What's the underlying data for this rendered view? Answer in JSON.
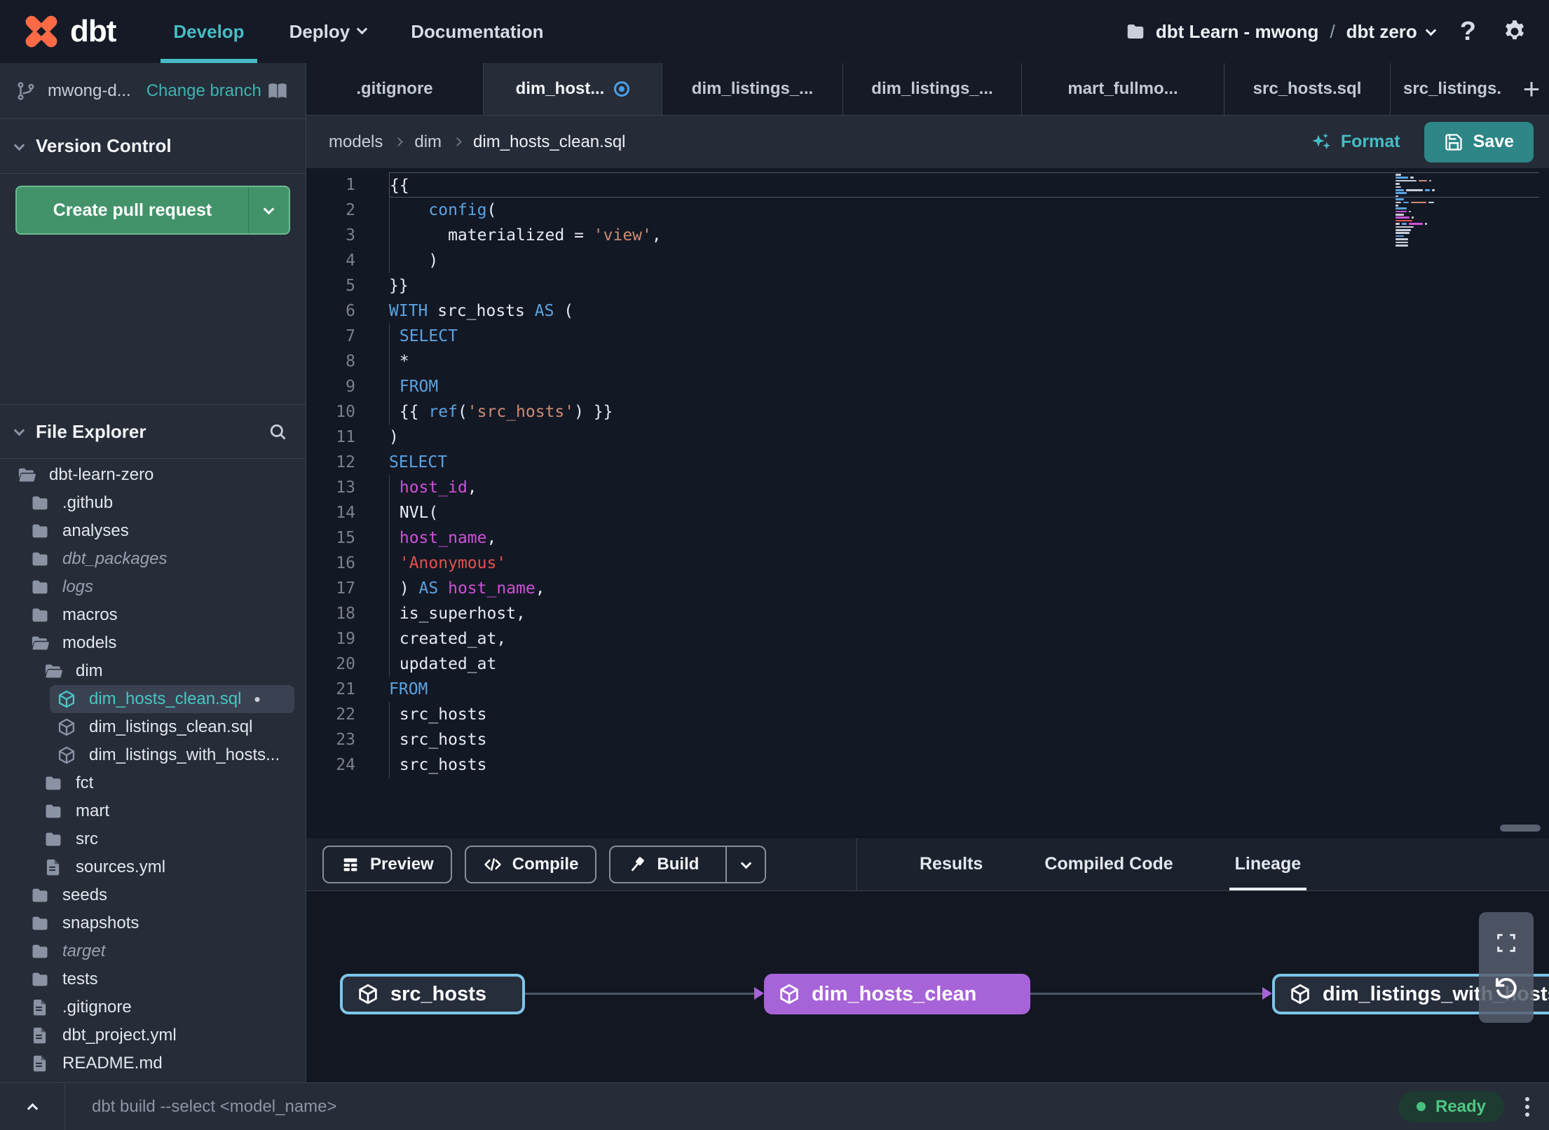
{
  "colors": {
    "accent_teal": "#45BCC5",
    "link_teal": "#3FB3B0",
    "pr_button_green": "#43936A",
    "save_button_teal": "#2E8686",
    "ready_green": "#4FC684",
    "lineage_node_cyan": "#7CC5E8",
    "lineage_node_purple": "#A763D8",
    "syntax_keyword_blue": "#5BA3E0",
    "syntax_string_salmon": "#CE8C75",
    "syntax_string_red": "#E0524C",
    "syntax_column_magenta": "#CE51D6",
    "modified_indicator_blue": "#4A9FE8"
  },
  "glyphs": {
    "modified_dot": "•",
    "add_tab": "+",
    "help": "?"
  },
  "navbar": {
    "logo_text": "dbt",
    "items": [
      {
        "label": "Develop",
        "active": true
      },
      {
        "label": "Deploy",
        "has_chevron": true
      },
      {
        "label": "Documentation"
      }
    ],
    "project": {
      "account": "dbt Learn - mwong",
      "separator": "/",
      "name": "dbt zero"
    }
  },
  "sidebar": {
    "branch": {
      "name": "mwong-d...",
      "change_label": "Change branch"
    },
    "version_control_title": "Version Control",
    "create_pr_label": "Create pull request",
    "file_explorer_title": "File Explorer",
    "tree": [
      {
        "label": "dbt-learn-zero",
        "icon": "folder-open",
        "depth": 0
      },
      {
        "label": ".github",
        "icon": "folder",
        "depth": 1
      },
      {
        "label": "analyses",
        "icon": "folder",
        "depth": 1
      },
      {
        "label": "dbt_packages",
        "icon": "folder",
        "depth": 1,
        "italic": true
      },
      {
        "label": "logs",
        "icon": "folder",
        "depth": 1,
        "italic": true
      },
      {
        "label": "macros",
        "icon": "folder",
        "depth": 1
      },
      {
        "label": "models",
        "icon": "folder-open",
        "depth": 1
      },
      {
        "label": "dim",
        "icon": "folder-open",
        "depth": 2
      },
      {
        "label": "dim_hosts_clean.sql",
        "icon": "model",
        "depth": 3,
        "selected": true,
        "modified": true
      },
      {
        "label": "dim_listings_clean.sql",
        "icon": "model",
        "depth": 3
      },
      {
        "label": "dim_listings_with_hosts...",
        "icon": "model",
        "depth": 3
      },
      {
        "label": "fct",
        "icon": "folder",
        "depth": 2
      },
      {
        "label": "mart",
        "icon": "folder",
        "depth": 2
      },
      {
        "label": "src",
        "icon": "folder",
        "depth": 2
      },
      {
        "label": "sources.yml",
        "icon": "file",
        "depth": 2
      },
      {
        "label": "seeds",
        "icon": "folder",
        "depth": 1
      },
      {
        "label": "snapshots",
        "icon": "folder",
        "depth": 1
      },
      {
        "label": "target",
        "icon": "folder",
        "depth": 1,
        "italic": true
      },
      {
        "label": "tests",
        "icon": "folder",
        "depth": 1
      },
      {
        "label": ".gitignore",
        "icon": "file",
        "depth": 1
      },
      {
        "label": "dbt_project.yml",
        "icon": "file",
        "depth": 1
      },
      {
        "label": "README.md",
        "icon": "file",
        "depth": 1
      }
    ]
  },
  "tabs": [
    {
      "label": ".gitignore"
    },
    {
      "label": "dim_host...",
      "active": true,
      "modified": true
    },
    {
      "label": "dim_listings_..."
    },
    {
      "label": "dim_listings_..."
    },
    {
      "label": "mart_fullmo..."
    },
    {
      "label": "src_hosts.sql"
    },
    {
      "label": "src_listings."
    }
  ],
  "editor_header": {
    "breadcrumb": [
      "models",
      "dim",
      "dim_hosts_clean.sql"
    ],
    "format_label": "Format",
    "save_label": "Save"
  },
  "editor": {
    "language": "sql",
    "lines": [
      {
        "n": 1,
        "cur": true,
        "t": [
          [
            "{{",
            "p"
          ]
        ]
      },
      {
        "n": 2,
        "g": true,
        "t": [
          [
            "    ",
            "p"
          ],
          [
            "config",
            "k"
          ],
          [
            "(",
            "p"
          ]
        ]
      },
      {
        "n": 3,
        "g": true,
        "t": [
          [
            "      materialized = ",
            "p"
          ],
          [
            "'view'",
            "s"
          ],
          [
            ",",
            "p"
          ]
        ]
      },
      {
        "n": 4,
        "g": true,
        "t": [
          [
            "    )",
            "p"
          ]
        ]
      },
      {
        "n": 5,
        "t": [
          [
            "}}",
            "p"
          ]
        ]
      },
      {
        "n": 6,
        "t": [
          [
            "WITH",
            "k"
          ],
          [
            " src_hosts ",
            "p"
          ],
          [
            "AS",
            "k"
          ],
          [
            " (",
            "p"
          ]
        ]
      },
      {
        "n": 7,
        "g": true,
        "t": [
          [
            " ",
            "p"
          ],
          [
            "SELECT",
            "k"
          ]
        ]
      },
      {
        "n": 8,
        "g": true,
        "t": [
          [
            " *",
            "p"
          ]
        ]
      },
      {
        "n": 9,
        "g": true,
        "t": [
          [
            " ",
            "p"
          ],
          [
            "FROM",
            "k"
          ]
        ]
      },
      {
        "n": 10,
        "g": true,
        "t": [
          [
            " {{ ",
            "p"
          ],
          [
            "ref",
            "k"
          ],
          [
            "(",
            "p"
          ],
          [
            "'src_hosts'",
            "s"
          ],
          [
            ") }}",
            "p"
          ]
        ]
      },
      {
        "n": 11,
        "t": [
          [
            ")",
            "p"
          ]
        ]
      },
      {
        "n": 12,
        "t": [
          [
            "SELECT",
            "k"
          ]
        ]
      },
      {
        "n": 13,
        "g": true,
        "t": [
          [
            " ",
            "p"
          ],
          [
            "host_id",
            "m"
          ],
          [
            ",",
            "p"
          ]
        ]
      },
      {
        "n": 14,
        "g": true,
        "t": [
          [
            " NVL(",
            "p"
          ]
        ]
      },
      {
        "n": 15,
        "g": true,
        "t": [
          [
            " ",
            "p"
          ],
          [
            "host_name",
            "m"
          ],
          [
            ",",
            "p"
          ]
        ]
      },
      {
        "n": 16,
        "g": true,
        "t": [
          [
            " ",
            "p"
          ],
          [
            "'Anonymous'",
            "r"
          ]
        ]
      },
      {
        "n": 17,
        "g": true,
        "t": [
          [
            " ) ",
            "p"
          ],
          [
            "AS",
            "k"
          ],
          [
            " ",
            "p"
          ],
          [
            "host_name",
            "m"
          ],
          [
            ",",
            "p"
          ]
        ]
      },
      {
        "n": 18,
        "g": true,
        "t": [
          [
            " is_superhost,",
            "p"
          ]
        ]
      },
      {
        "n": 19,
        "g": true,
        "t": [
          [
            " created_at,",
            "p"
          ]
        ]
      },
      {
        "n": 20,
        "g": true,
        "t": [
          [
            " updated_at",
            "p"
          ]
        ]
      },
      {
        "n": 21,
        "t": [
          [
            "FROM",
            "k"
          ]
        ]
      },
      {
        "n": 22,
        "g": true,
        "t": [
          [
            " src_hosts",
            "p"
          ]
        ]
      },
      {
        "n": 23,
        "g": true,
        "t": [
          [
            " src_hosts",
            "p"
          ]
        ]
      },
      {
        "n": 24,
        "g": true,
        "t": [
          [
            " src_hosts",
            "p"
          ]
        ]
      }
    ]
  },
  "bottom_toolbar": {
    "buttons": [
      {
        "label": "Preview"
      },
      {
        "label": "Compile"
      },
      {
        "label": "Build",
        "has_dropdown": true
      }
    ],
    "tabs": [
      {
        "label": "Results"
      },
      {
        "label": "Compiled Code"
      },
      {
        "label": "Lineage",
        "active": true
      }
    ]
  },
  "lineage": {
    "nodes": [
      {
        "label": "src_hosts",
        "kind": "source"
      },
      {
        "label": "dim_hosts_clean",
        "kind": "selected-model"
      },
      {
        "label": "dim_listings_with_hosts",
        "kind": "model"
      }
    ]
  },
  "status_bar": {
    "command": "dbt build --select <model_name>",
    "ready_label": "Ready"
  }
}
